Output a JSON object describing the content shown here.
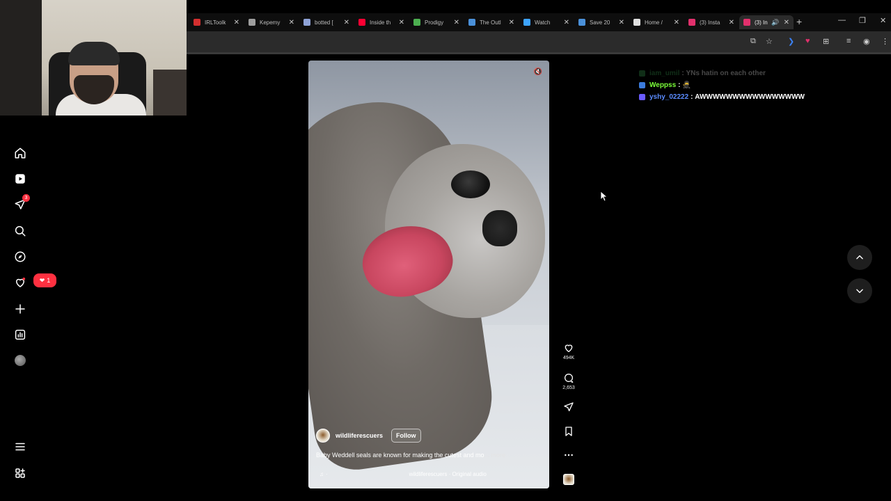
{
  "browser": {
    "tabs": [
      {
        "label": "IRLToolk",
        "icon": "irltoolkit-icon",
        "color": "#d32f2f"
      },
      {
        "label": "Kepemy",
        "icon": "globe-icon",
        "color": "#9e9e9e"
      },
      {
        "label": "botted [",
        "icon": "discord-icon",
        "color": "#8ea2d6"
      },
      {
        "label": "Inside th",
        "icon": "youtube-icon",
        "color": "#ff0033"
      },
      {
        "label": "Prodigy",
        "icon": "leaf-icon",
        "color": "#4caf50"
      },
      {
        "label": "The Outl",
        "icon": "steam-icon",
        "color": "#4a90d9"
      },
      {
        "label": "Watch",
        "icon": "play-circle-icon",
        "color": "#3da3ff"
      },
      {
        "label": "Save 20",
        "icon": "steam-icon",
        "color": "#4a90d9"
      },
      {
        "label": "Home / ",
        "icon": "x-logo-icon",
        "color": "#e0e0e0"
      },
      {
        "label": "(3) Insta",
        "icon": "instagram-icon",
        "color": "#e1306c"
      },
      {
        "label": "(3) In",
        "icon": "instagram-icon",
        "color": "#e1306c",
        "active": true
      }
    ]
  },
  "nav": {
    "messages_badge": "3",
    "notifications_count": "1"
  },
  "reel": {
    "username": "wildliferescuers",
    "follow_label": "Follow",
    "caption": "Baby Weddell seals are known for making the cutest and mo",
    "caption_more": "... more",
    "audio_marker": "·",
    "audio_track": "wildliferescuers · Original audio",
    "likes": "494K",
    "comments": "2,653"
  },
  "chat": [
    {
      "user": "iam_umil",
      "message": "YNs hatin on each other",
      "user_color": "#3aa655",
      "faded": true,
      "badge_color": "#3aa655"
    },
    {
      "user": "Weppss",
      "message": "🥷",
      "user_color": "#7cff3a",
      "faded": false,
      "badge_color": "#3b7bdc"
    },
    {
      "user": "yshy_02222",
      "message": "AWWWWWWWWWWWWWWWW",
      "user_color": "#5b8cff",
      "faded": false,
      "badge_color": "#6a5bff"
    }
  ],
  "colors": {
    "accent_red": "#ff3040",
    "background": "#000000"
  }
}
